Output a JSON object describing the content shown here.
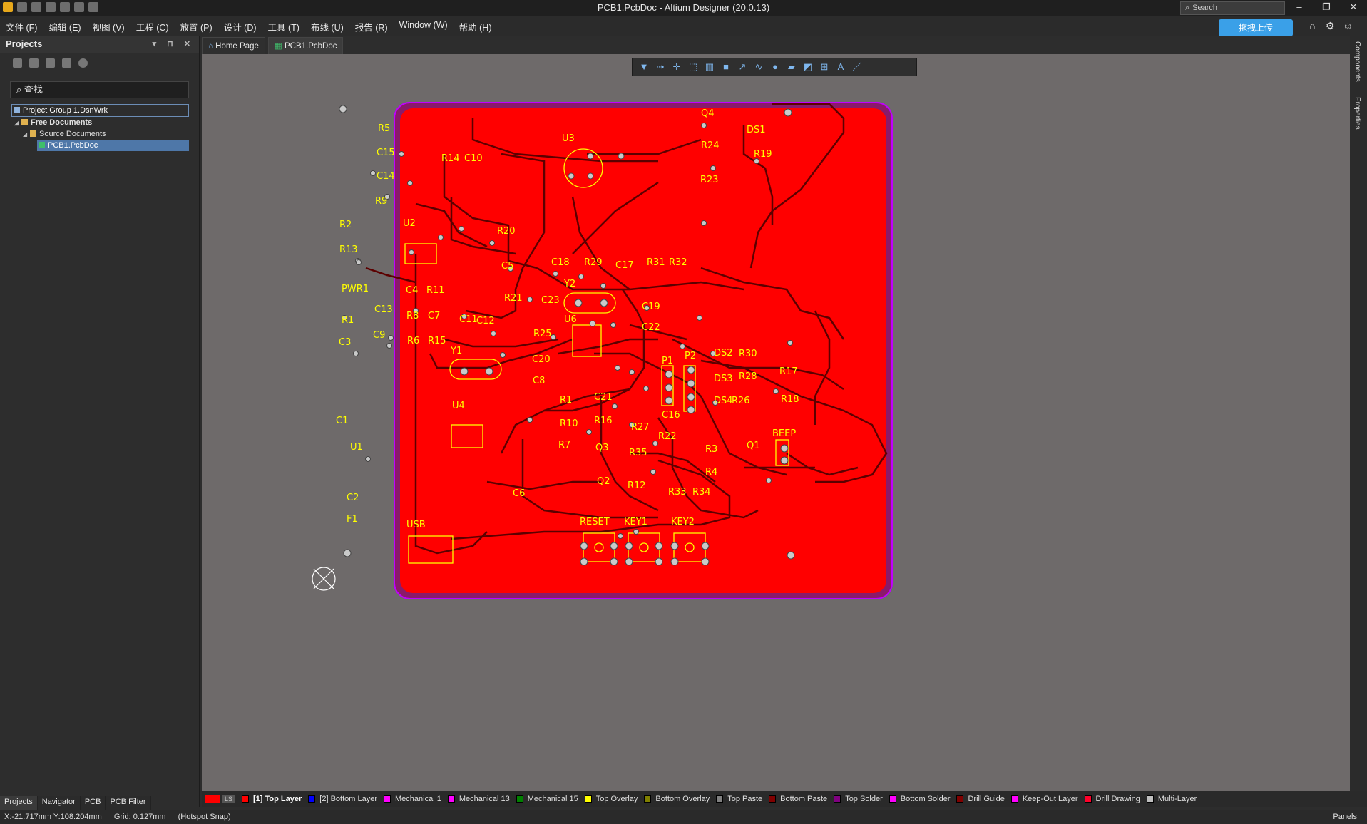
{
  "window": {
    "title": "PCB1.PcbDoc - Altium Designer (20.0.13)",
    "search_placeholder": "Search",
    "buttons": [
      "–",
      "❐",
      "✕"
    ]
  },
  "menu": [
    "文件 (F)",
    "编辑 (E)",
    "视图 (V)",
    "工程 (C)",
    "放置 (P)",
    "设计 (D)",
    "工具 (T)",
    "布线 (U)",
    "报告 (R)",
    "Window (W)",
    "帮助 (H)"
  ],
  "upload_button": "拖拽上传",
  "projects_panel": {
    "title": "Projects",
    "search_value": "查找",
    "tree": [
      {
        "label": "Project Group 1.DsnWrk",
        "level": 0,
        "selected": false
      },
      {
        "label": "Free Documents",
        "level": 1,
        "selected": false
      },
      {
        "label": "Source Documents",
        "level": 2,
        "selected": false
      },
      {
        "label": "PCB1.PcbDoc",
        "level": 3,
        "selected": true
      }
    ],
    "bottom_tabs": [
      "Projects",
      "Navigator",
      "PCB",
      "PCB Filter"
    ]
  },
  "doc_tabs": [
    "Home Page",
    "PCB1.PcbDoc"
  ],
  "right_panels": [
    "Components",
    "Properties"
  ],
  "layers": [
    {
      "name": "[1] Top Layer",
      "color": "#ff0000",
      "active": true
    },
    {
      "name": "[2] Bottom Layer",
      "color": "#0000ff",
      "active": false
    },
    {
      "name": "Mechanical 1",
      "color": "#ff00ff",
      "active": false
    },
    {
      "name": "Mechanical 13",
      "color": "#ff00ff",
      "active": false
    },
    {
      "name": "Mechanical 15",
      "color": "#008000",
      "active": false
    },
    {
      "name": "Top Overlay",
      "color": "#ffff00",
      "active": false
    },
    {
      "name": "Bottom Overlay",
      "color": "#808000",
      "active": false
    },
    {
      "name": "Top Paste",
      "color": "#808080",
      "active": false
    },
    {
      "name": "Bottom Paste",
      "color": "#800000",
      "active": false
    },
    {
      "name": "Top Solder",
      "color": "#800080",
      "active": false
    },
    {
      "name": "Bottom Solder",
      "color": "#ff00ff",
      "active": false
    },
    {
      "name": "Drill Guide",
      "color": "#800000",
      "active": false
    },
    {
      "name": "Keep-Out Layer",
      "color": "#ff00ff",
      "active": false
    },
    {
      "name": "Drill Drawing",
      "color": "#ff002a",
      "active": false
    },
    {
      "name": "Multi-Layer",
      "color": "#c0c0c0",
      "active": false
    }
  ],
  "layer_set_label": "LS",
  "status": {
    "coords": "X:-21.717mm Y:108.204mm",
    "grid": "Grid: 0.127mm",
    "snap": "(Hotspot Snap)",
    "panels": "Panels"
  },
  "colors": {
    "board": "#ff0000",
    "overlay": "#ffff00",
    "trace": "#6b0000",
    "keepout": "#c000ff"
  },
  "pcb": {
    "labels": [
      "R5",
      "C15",
      "C14",
      "R9",
      "R2",
      "U2",
      "R13",
      "PWR1",
      "R1",
      "C3",
      "C13",
      "C9",
      "C4",
      "R8",
      "R6",
      "R11",
      "C7",
      "R15",
      "R14",
      "C10",
      "U3",
      "R20",
      "C11",
      "C12",
      "Y1",
      "R21",
      "C5",
      "C18",
      "R29",
      "C17",
      "R31",
      "R32",
      "Y2",
      "C23",
      "U6",
      "C19",
      "C22",
      "R25",
      "C20",
      "C8",
      "U4",
      "R10",
      "R7",
      "C21",
      "R16",
      "C1",
      "U1",
      "C2",
      "F1",
      "USB",
      "C6",
      "R33",
      "R34",
      "Q2",
      "R12",
      "Q3",
      "R35",
      "R27",
      "R22",
      "C16",
      "P1",
      "P2",
      "DS2",
      "DS3",
      "DS4",
      "R26",
      "R28",
      "R30",
      "R3",
      "R4",
      "Q1",
      "BEEP",
      "R17",
      "R18",
      "Q4",
      "R24",
      "R23",
      "DS1",
      "R19",
      "RESET",
      "KEY1",
      "KEY2",
      "R1"
    ]
  }
}
